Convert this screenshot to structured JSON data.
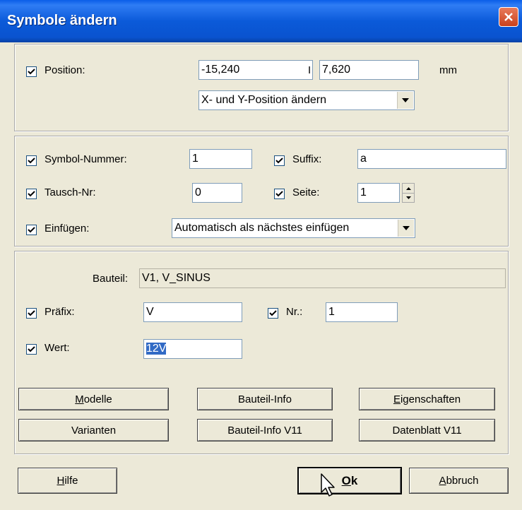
{
  "window": {
    "title": "Symbole ändern"
  },
  "position": {
    "label": "Position:",
    "x_value": "-15,240",
    "separator": "I",
    "y_value": "7,620",
    "unit": "mm",
    "mode_selected": "X- und Y-Position ändern"
  },
  "symbol": {
    "number_label": "Symbol-Nummer:",
    "number_value": "1",
    "suffix_label": "Suffix:",
    "suffix_value": "a",
    "exchange_label": "Tausch-Nr:",
    "exchange_value": "0",
    "page_label": "Seite:",
    "page_value": "1",
    "insert_label": "Einfügen:",
    "insert_selected": "Automatisch als nächstes einfügen"
  },
  "component": {
    "part_label": "Bauteil:",
    "part_value": "V1, V_SINUS",
    "prefix_label": "Präfix:",
    "prefix_value": "V",
    "nr_label": "Nr.:",
    "nr_value": "1",
    "value_label": "Wert:",
    "value_value": "12V"
  },
  "buttons": {
    "models_first": "M",
    "models_rest": "odelle",
    "part_info": "Bauteil-Info",
    "properties_first": "E",
    "properties_rest": "igenschaften",
    "variants": "Varianten",
    "part_info_v11": "Bauteil-Info V11",
    "datasheet_v11": "Datenblatt V11",
    "help_first": "H",
    "help_rest": "ilfe",
    "ok_first": "O",
    "ok_rest": "k",
    "cancel_first": "A",
    "cancel_rest": "bbruch"
  },
  "colors": {
    "title_bar": "#0a5ee8",
    "dialog_bg": "#ece9d8",
    "selection": "#316ac5"
  }
}
